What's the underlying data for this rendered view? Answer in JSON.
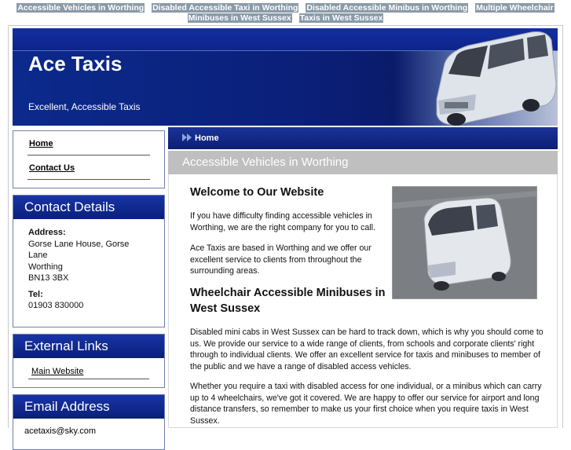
{
  "topnav": {
    "links": [
      "Accessible Vehicles in Worthing",
      "Disabled Accessible Taxi in Worthing",
      "Disabled Accessible Minibus in Worthing",
      "Multiple Wheelchair",
      "Minibuses in West Sussex",
      "Taxis in West Sussex"
    ]
  },
  "header": {
    "title": "Ace Taxis",
    "tagline": "Excellent, Accessible Taxis"
  },
  "nav": {
    "items": [
      "Home",
      "Contact Us"
    ]
  },
  "contact": {
    "heading": "Contact Details",
    "address_label": "Address:",
    "address_lines": [
      "Gorse Lane House, Gorse Lane",
      "Worthing",
      "BN13 3BX"
    ],
    "tel_label": "Tel:",
    "tel": "01903 830000"
  },
  "external": {
    "heading": "External Links",
    "link": "Main Website"
  },
  "email": {
    "heading": "Email Address",
    "address": "acetaxis@sky.com"
  },
  "breadcrumb": {
    "current": "Home"
  },
  "main": {
    "page_heading": "Accessible Vehicles in Worthing",
    "welcome_heading": "Welcome to Our Website",
    "para1": "If you have difficulty finding accessible vehicles in Worthing, we are the right company for you to call.",
    "para2": "Ace Taxis are based in Worthing and we offer our excellent service to clients from throughout the surrounding areas.",
    "section_heading": "Wheelchair Accessible Minibuses in West Sussex",
    "para3": "Disabled mini cabs in West Sussex can be hard to track down, which is why you should come to us. We provide our service to a wide range of clients, from schools and corporate clients' right through to individual clients. We offer an excellent service for taxis and minibuses to member of the public and we have a range of disabled access vehicles.",
    "para4": "Whether you require a taxi with disabled access for one individual, or a minibus which can carry up to 4 wheelchairs, we've got it covered. We are happy to offer our service for airport and long distance transfers, so remember to make us your first choice when you require taxis in West Sussex."
  },
  "colors": {
    "brand_blue": "#0b1f78",
    "page_heading_grey": "#bfbfbf"
  }
}
